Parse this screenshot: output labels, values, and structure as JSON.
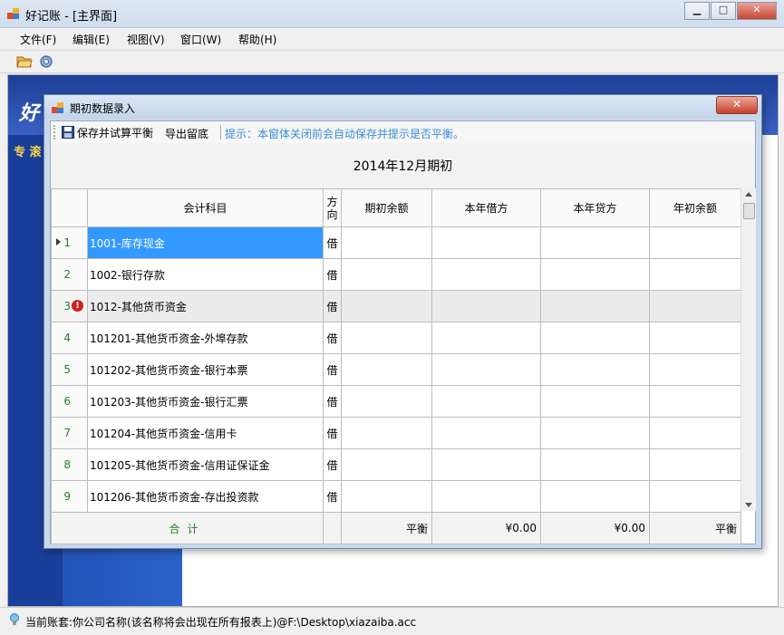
{
  "window": {
    "title": "好记账 - [主界面]",
    "buttons": {
      "minimize": "▁",
      "maximize": "□",
      "close": "✕"
    }
  },
  "menu": [
    "文件(F)",
    "编辑(E)",
    "视图(V)",
    "窗口(W)",
    "帮助(H)"
  ],
  "background": {
    "logo": "好",
    "side_label": "专 滚"
  },
  "dialog": {
    "title": "期初数据录入",
    "close": "✕",
    "toolbar": {
      "save_label": "保存并试算平衡",
      "export_label": "导出留底",
      "tip": "提示：本窗体关闭前会自动保存并提示是否平衡。"
    },
    "period_title": "2014年12月期初",
    "grid": {
      "headers": [
        "会计科目",
        "方向",
        "期初余额",
        "本年借方",
        "本年贷方",
        "年初余额"
      ],
      "rows": [
        {
          "num": "1",
          "account": "1001-库存现金",
          "dir": "借"
        },
        {
          "num": "2",
          "account": "1002-银行存款",
          "dir": "借"
        },
        {
          "num": "3",
          "account": "1012-其他货币资金",
          "dir": "借"
        },
        {
          "num": "4",
          "account": "101201-其他货币资金-外埠存款",
          "dir": "借"
        },
        {
          "num": "5",
          "account": "101202-其他货币资金-银行本票",
          "dir": "借"
        },
        {
          "num": "6",
          "account": "101203-其他货币资金-银行汇票",
          "dir": "借"
        },
        {
          "num": "7",
          "account": "101204-其他货币资金-信用卡",
          "dir": "借"
        },
        {
          "num": "8",
          "account": "101205-其他货币资金-信用证保证金",
          "dir": "借"
        },
        {
          "num": "9",
          "account": "101206-其他货币资金-存出投资款",
          "dir": "借"
        }
      ],
      "selected_row": 1,
      "error_row": 3,
      "error_mark": "!",
      "totals": {
        "label": "合计",
        "opening": "平衡",
        "debit": "¥0.00",
        "credit": "¥0.00",
        "year_start": "平衡"
      }
    }
  },
  "status": {
    "text": "当前账套:你公司名称(该名称将会出现在所有报表上)@F:\\Desktop\\xiazaiba.acc"
  },
  "colors": {
    "selected": "#3399ff",
    "row_number": "#2b7d2b",
    "tip": "#3a8bd8",
    "error": "#d01f1f"
  }
}
